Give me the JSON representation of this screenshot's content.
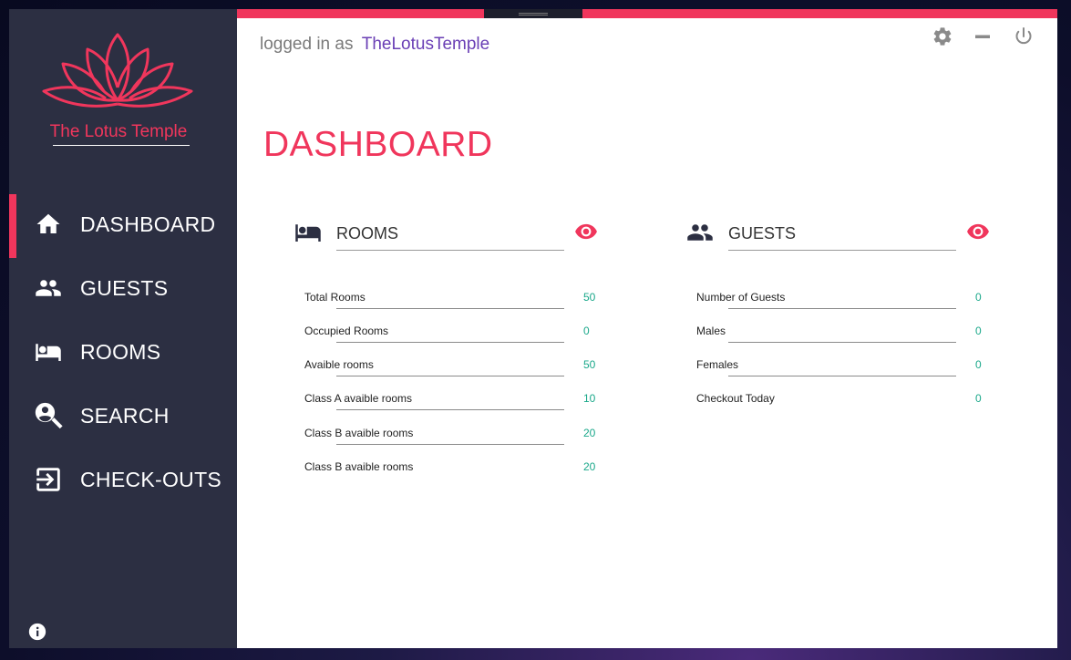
{
  "app": {
    "brand": "The Lotus Temple"
  },
  "colors": {
    "accent": "#f0365c",
    "sidebar": "#2c2f42",
    "value": "#1aa88a",
    "user": "#6a3fb5"
  },
  "sidebar": {
    "items": [
      {
        "label": "DASHBOARD",
        "icon": "home-icon",
        "active": true
      },
      {
        "label": "GUESTS",
        "icon": "people-icon",
        "active": false
      },
      {
        "label": "ROOMS",
        "icon": "bed-icon",
        "active": false
      },
      {
        "label": "SEARCH",
        "icon": "person-search-icon",
        "active": false
      },
      {
        "label": "CHECK-OUTS",
        "icon": "exit-icon",
        "active": false
      }
    ],
    "info_icon": "info-icon"
  },
  "header": {
    "logged_prefix": "logged in as",
    "username": "TheLotusTemple",
    "controls": [
      "gear-icon",
      "minimize-icon",
      "power-icon"
    ]
  },
  "page": {
    "title": "DASHBOARD"
  },
  "rooms": {
    "title": "ROOMS",
    "icon": "bed-icon",
    "stats": [
      {
        "label": "Total Rooms",
        "value": "50"
      },
      {
        "label": "Occupied Rooms",
        "value": "0"
      },
      {
        "label": "Avaible rooms",
        "value": "50"
      },
      {
        "label": "Class A avaible rooms",
        "value": "10"
      },
      {
        "label": "Class B avaible rooms",
        "value": "20"
      },
      {
        "label": "Class B avaible rooms",
        "value": "20"
      }
    ]
  },
  "guests": {
    "title": "GUESTS",
    "icon": "people-icon",
    "stats": [
      {
        "label": "Number of Guests",
        "value": "0"
      },
      {
        "label": "Males",
        "value": "0"
      },
      {
        "label": "Females",
        "value": "0"
      },
      {
        "label": "Checkout Today",
        "value": "0"
      }
    ]
  }
}
